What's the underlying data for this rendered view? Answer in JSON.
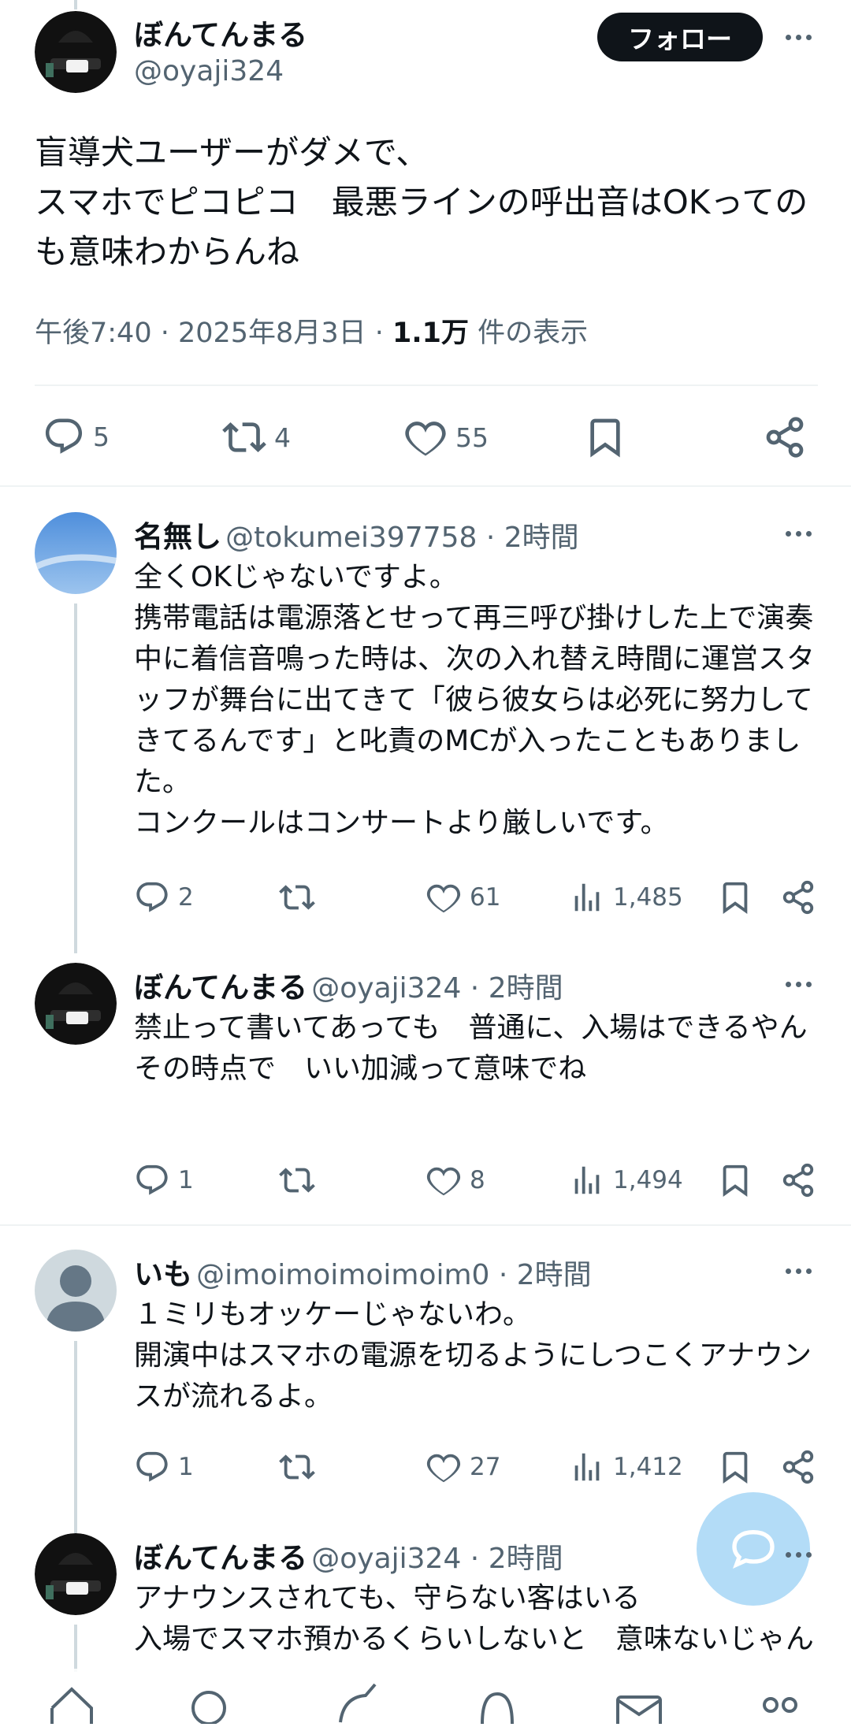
{
  "main_tweet": {
    "author_name": "ぼんてんまる",
    "author_handle": "@oyaji324",
    "follow_label": "フォロー",
    "text": "盲導犬ユーザーがダメで、\nスマホでピコピコ　最悪ラインの呼出音はOKってのも意味わからんね",
    "time": "午後7:40 · 2025年8月3日 · ",
    "views_count": "1.1万",
    "views_label": " 件の表示",
    "replies": "5",
    "retweets": "4",
    "likes": "55"
  },
  "replies": [
    {
      "name": "名無し",
      "handle": "@tokumei397758 · 2時間",
      "text": "全くOKじゃないですよ。\n携帯電話は電源落とせって再三呼び掛けした上で演奏中に着信音鳴った時は、次の入れ替え時間に運営スタッフが舞台に出てきて「彼ら彼女らは必死に努力してきてるんです」と叱責のMCが入ったこともありました。\nコンクールはコンサートより厳しいです。",
      "replies": "2",
      "retweets": "",
      "likes": "61",
      "views": "1,485"
    },
    {
      "name": "ぼんてんまる",
      "handle": "@oyaji324 · 2時間",
      "text": "禁止って書いてあっても　普通に、入場はできるやん\nその時点で　いい加減って意味でね",
      "replies": "1",
      "retweets": "",
      "likes": "8",
      "views": "1,494"
    },
    {
      "name": "いも",
      "handle": "@imoimoimoimoim0 · 2時間",
      "text": "１ミリもオッケーじゃないわ。\n開演中はスマホの電源を切るようにしつこくアナウンスが流れるよ。",
      "replies": "1",
      "retweets": "",
      "likes": "27",
      "views": "1,412"
    },
    {
      "name": "ぼんてんまる",
      "handle": "@oyaji324 · 2時間",
      "text": "アナウンスされても、守らない客はいる\n入場でスマホ預かるくらいしないと　意味ないじゃん"
    }
  ],
  "colors": {
    "text": "#0f1419",
    "muted": "#536471",
    "fab": "#b3dcf7",
    "divider": "#eff3f4"
  },
  "icons": [
    "reply-icon",
    "retweet-icon",
    "like-icon",
    "views-icon",
    "bookmark-icon",
    "share-icon",
    "more-icon",
    "compose-message-icon",
    "home-icon",
    "search-icon",
    "grok-icon",
    "notifications-icon",
    "messages-icon",
    "communities-icon"
  ]
}
